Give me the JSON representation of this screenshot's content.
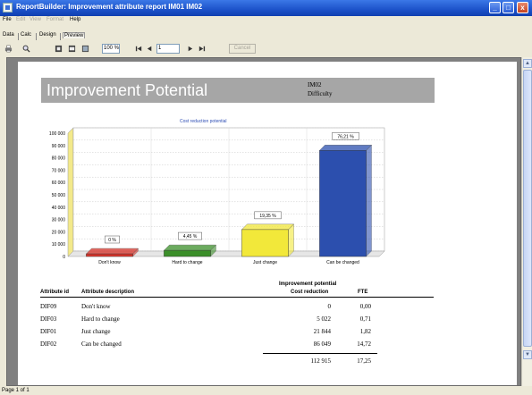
{
  "window": {
    "title": "ReportBuilder: Improvement attribute report IM01 IM02",
    "controls": [
      "_",
      "□",
      "x"
    ]
  },
  "menu": {
    "items": [
      {
        "label": "File",
        "enabled": true
      },
      {
        "label": "Edit",
        "enabled": false
      },
      {
        "label": "View",
        "enabled": false
      },
      {
        "label": "Format",
        "enabled": false
      },
      {
        "label": "Help",
        "enabled": true
      }
    ]
  },
  "tabs": [
    "Data",
    "Calc",
    "Design",
    "Preview"
  ],
  "toolbar": {
    "zoom": "100 %",
    "page": "1",
    "cancel_label": "Cancel",
    "icons": [
      "print-icon",
      "zoom-icon",
      "whole-page-icon",
      "page-width-icon",
      "hundred-percent-icon",
      "first-page-icon",
      "prev-page-icon",
      "next-page-icon",
      "last-page-icon"
    ]
  },
  "report": {
    "title": "Improvement Potential",
    "code": "IM02",
    "subtitle": "Difficulty"
  },
  "chart_data": {
    "type": "bar",
    "title": "Cost reduction potential",
    "categories": [
      "Don't know",
      "Hard to change",
      "Just change",
      "Can be changed"
    ],
    "values": [
      0,
      5022,
      21844,
      86049
    ],
    "data_labels": [
      "0 %",
      "4,45 %",
      "19,35 %",
      "76,21 %"
    ],
    "colors": [
      "#d9342b",
      "#3c8f2a",
      "#f2e83a",
      "#2c4fae"
    ],
    "yticks": [
      "0",
      "10 000",
      "20 000",
      "30 000",
      "40 000",
      "50 000",
      "60 000",
      "70 000",
      "80 000",
      "90 000",
      "100 000"
    ],
    "ylim": [
      0,
      100000
    ],
    "grid": true
  },
  "table": {
    "group_header": "Improvement potential",
    "headers": [
      "Attribute id",
      "Attribute description",
      "Cost reduction",
      "FTE"
    ],
    "rows": [
      [
        "DIF09",
        "Don't know",
        "0",
        "0,00"
      ],
      [
        "DIF03",
        "Hard to change",
        "5 022",
        "0,71"
      ],
      [
        "DIF01",
        "Just change",
        "21 844",
        "1,82"
      ],
      [
        "DIF02",
        "Can be changed",
        "86 049",
        "14,72"
      ]
    ],
    "totals": [
      "112 915",
      "17,25"
    ]
  },
  "status": "Page 1 of 1"
}
